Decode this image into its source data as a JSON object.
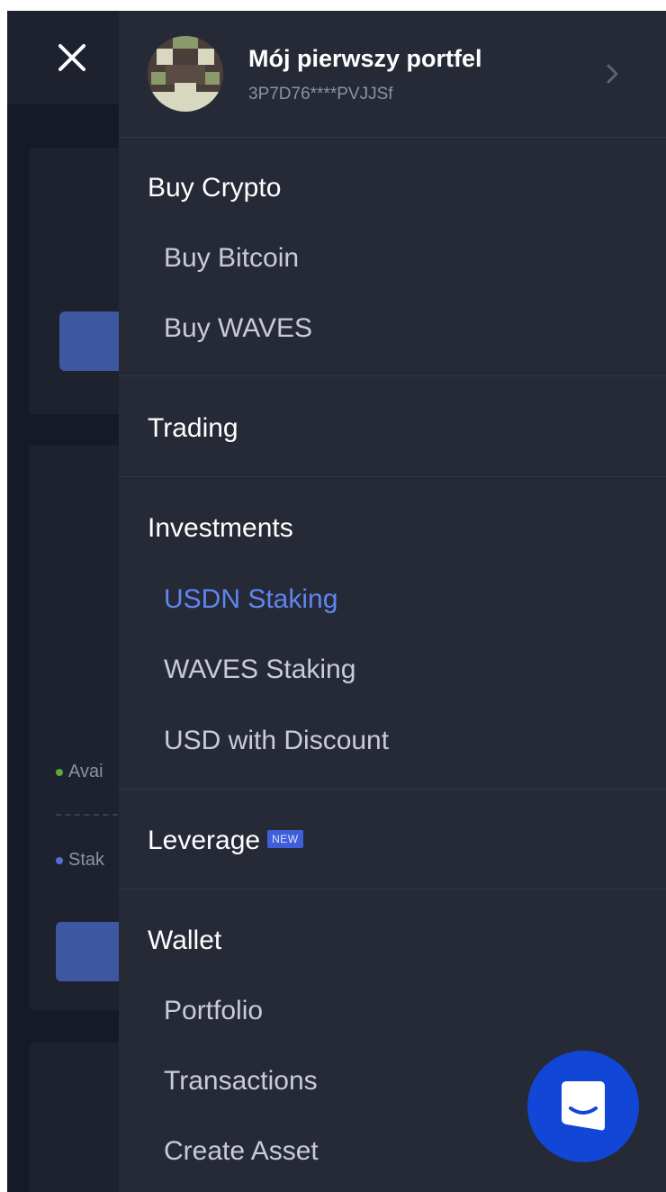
{
  "profile": {
    "wallet_name": "Mój pierwszy portfel",
    "address": "3P7D76****PVJJSf"
  },
  "background": {
    "available_label": "Avai",
    "staked_label": "Stak"
  },
  "menu": {
    "buy_crypto": {
      "title": "Buy Crypto",
      "items": [
        "Buy Bitcoin",
        "Buy WAVES"
      ]
    },
    "trading": {
      "title": "Trading"
    },
    "investments": {
      "title": "Investments",
      "items": [
        "USDN Staking",
        "WAVES Staking",
        "USD with Discount"
      ],
      "active_index": 0
    },
    "leverage": {
      "title": "Leverage",
      "badge": "NEW"
    },
    "wallet": {
      "title": "Wallet",
      "items": [
        "Portfolio",
        "Transactions",
        "Create Asset"
      ]
    }
  },
  "icons": {
    "close": "close-icon",
    "chevron": "chevron-right-icon",
    "chat": "chat-icon"
  },
  "colors": {
    "drawer_bg": "#262a37",
    "page_bg": "#161a26",
    "accent": "#5f86f0",
    "primary_button": "#3d57a1",
    "chat_button": "#1246d6",
    "badge": "#3f5fd8",
    "available_dot": "#5fa83a",
    "staked_dot": "#4f6fd8"
  }
}
